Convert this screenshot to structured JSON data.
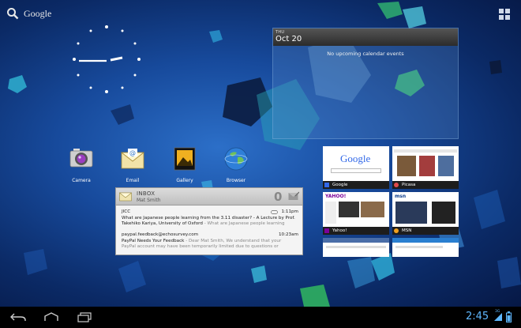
{
  "search": {
    "label": "Google",
    "icon": "search-icon"
  },
  "calendar": {
    "day_of_week": "THU",
    "date": "Oct 20",
    "empty_message": "No upcoming calendar events"
  },
  "apps": [
    {
      "name": "Camera",
      "icon": "camera-icon"
    },
    {
      "name": "Email",
      "icon": "email-icon"
    },
    {
      "name": "Gallery",
      "icon": "gallery-icon"
    },
    {
      "name": "Browser",
      "icon": "browser-icon"
    }
  ],
  "browser_tabs": [
    {
      "title": "Google"
    },
    {
      "title": "Picasa"
    },
    {
      "title": "Yahoo!"
    },
    {
      "title": "MSN"
    }
  ],
  "thumbnails": {
    "google_logo": "Google",
    "yahoo_logo": "YAHOO!",
    "msn_logo": "msn"
  },
  "email": {
    "folder": "INBOX",
    "account": "Mat Smith",
    "unread_count": "0",
    "messages": [
      {
        "from": "JICC",
        "time": "1:11pm",
        "subject": "What are Japanese people learning from the 3.11 disaster? - A Lecture by Prof.",
        "subject2": "Takehiko Kariya, University of Oxford",
        "snippet": " - What are Japanese people learning"
      },
      {
        "from": "paypal.feedback@echosurvey.com",
        "time": "10:23am",
        "subject": "PayPal Needs Your Feedback",
        "snippet": " - Dear Mat Smith, We understand that your",
        "snippet2": "PayPal account may have been temporarily limited due to questions or"
      }
    ]
  },
  "status": {
    "time": "2:45",
    "network": "3G"
  },
  "colors": {
    "accent": "#5fb8ff",
    "wallpaper": "#174a9c"
  }
}
